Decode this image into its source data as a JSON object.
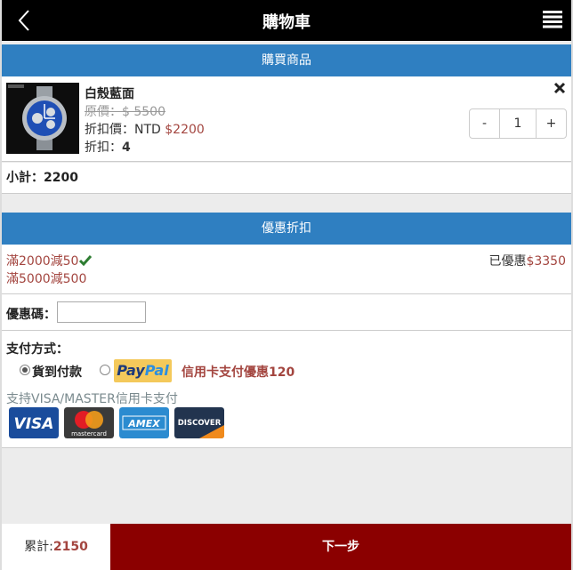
{
  "header": {
    "title": "購物車",
    "back_icon": "back-chevron-icon",
    "menu_icon": "list-menu-icon"
  },
  "cart": {
    "section_title": "購買商品",
    "item": {
      "name": "白殼藍面",
      "original_price_text": "原價：$ 5500",
      "discount_label": "折扣價：NTD ",
      "discount_price": "$2200",
      "rate_label": "折扣：",
      "rate_value": "4",
      "quantity": "1",
      "minus_label": "-",
      "plus_label": "+"
    },
    "subtotal_text": "小計：2200"
  },
  "discount": {
    "section_title": "優惠折扣",
    "rules": [
      "滿2000減50",
      "滿5000減500"
    ],
    "saved_label": "已優惠",
    "saved_amount": "$3350"
  },
  "coupon": {
    "label": "優惠碼：",
    "value": ""
  },
  "payment": {
    "label": "支付方式：",
    "cod_label": "貨到付款",
    "cod_selected": true,
    "paypal_selected": false,
    "paypal_part1": "Pay",
    "paypal_part2": "Pal",
    "paypal_promo": "信用卡支付優惠120",
    "card_note": "支持VISA/MASTER信用卡支付",
    "cards": [
      {
        "name": "VISA",
        "icon": "visa-icon"
      },
      {
        "name": "mastercard",
        "icon": "mastercard-icon"
      },
      {
        "name": "AMEX",
        "icon": "amex-icon"
      },
      {
        "name": "DISCOVER",
        "icon": "discover-icon"
      }
    ]
  },
  "footer": {
    "total_label": "累計:",
    "total_amount": "2150",
    "next_label": "下一步"
  },
  "colors": {
    "header_bg": "#000000",
    "section_bg": "#2f7fc1",
    "accent_red": "#a3453f",
    "next_bg": "#8b0000"
  }
}
